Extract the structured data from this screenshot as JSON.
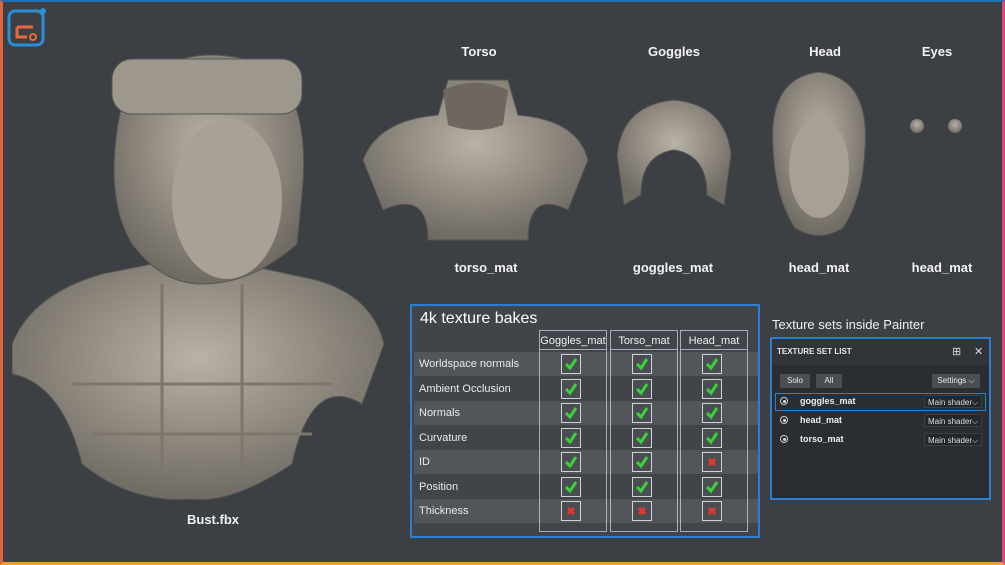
{
  "parts": [
    {
      "title": "Torso",
      "material": "torso_mat"
    },
    {
      "title": "Goggles",
      "material": "goggles_mat"
    },
    {
      "title": "Head",
      "material": "head_mat"
    },
    {
      "title": "Eyes",
      "material": "head_mat"
    }
  ],
  "bust_label": "Bust.fbx",
  "bakes": {
    "title": "4k texture bakes",
    "columns": [
      "Goggles_mat",
      "Torso_mat",
      "Head_mat"
    ],
    "rows": [
      {
        "label": "Worldspace normals",
        "values": [
          "check",
          "check",
          "check"
        ]
      },
      {
        "label": "Ambient Occlusion",
        "values": [
          "check",
          "check",
          "check"
        ]
      },
      {
        "label": "Normals",
        "values": [
          "check",
          "check",
          "check"
        ]
      },
      {
        "label": "Curvature",
        "values": [
          "check",
          "check",
          "check"
        ]
      },
      {
        "label": "ID",
        "values": [
          "check",
          "check",
          "cross"
        ]
      },
      {
        "label": "Position",
        "values": [
          "check",
          "check",
          "check"
        ]
      },
      {
        "label": "Thickness",
        "values": [
          "cross",
          "cross",
          "cross"
        ]
      }
    ],
    "colors": {
      "check": "#3ad13a",
      "cross": "#e03a2a"
    }
  },
  "texture_sets": {
    "caption": "Texture sets inside Painter",
    "panel_title": "TEXTURE SET LIST",
    "solo_label": "Solo",
    "all_label": "All",
    "settings_label": "Settings",
    "items": [
      {
        "name": "goggles_mat",
        "shader": "Main shader"
      },
      {
        "name": "head_mat",
        "shader": "Main shader"
      },
      {
        "name": "torso_mat",
        "shader": "Main shader"
      }
    ],
    "icons": [
      "dock-icon",
      "close-icon"
    ]
  },
  "accent_color": "#2a7fd0"
}
